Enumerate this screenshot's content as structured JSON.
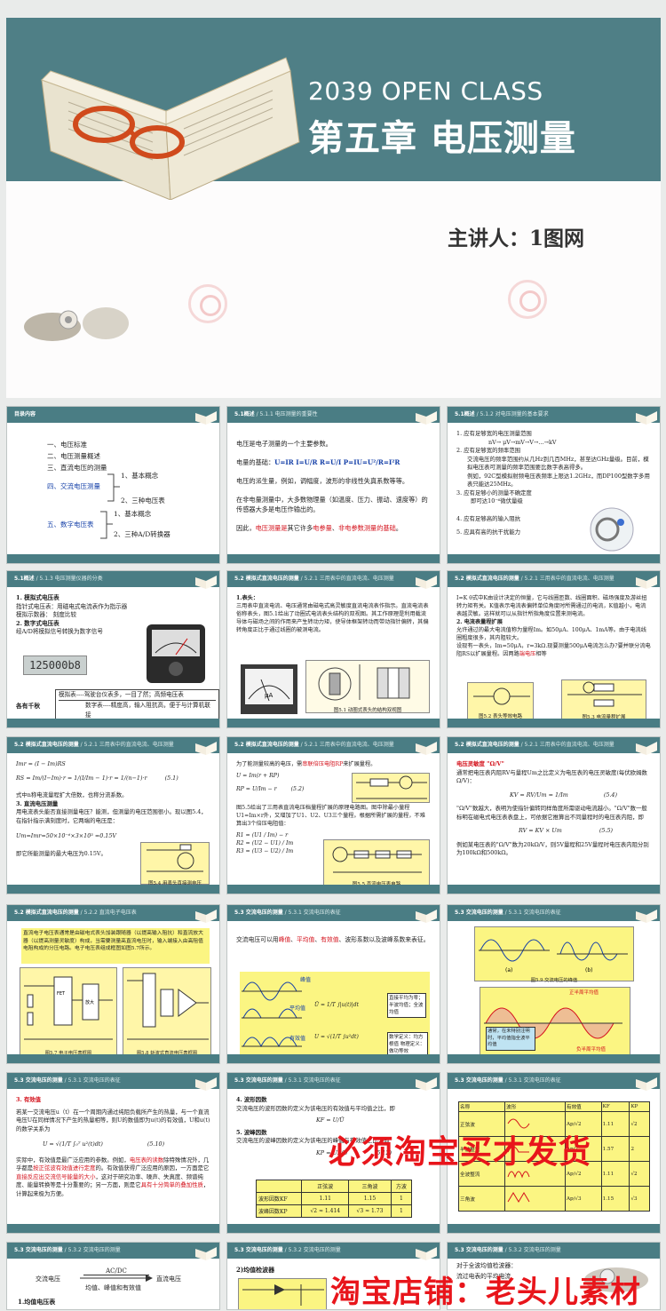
{
  "cover": {
    "title_en": "2039 OPEN CLASS",
    "title_cn": "第五章  电压测量",
    "presenter": "主讲人：1图网"
  },
  "slides": {
    "toc": {
      "bar": "目录内容",
      "items": [
        "一、电压标准",
        "二、电压测量概述",
        "三、直流电压的测量",
        "四、交流电压测量",
        "五、数字电压表"
      ],
      "sub1": [
        "1、基本概念",
        "2、三种电压表"
      ],
      "sub2": [
        "1、基本概念",
        "2、三种A/D转换器"
      ]
    },
    "s512": {
      "bar_a": "5.1概述",
      "bar_b": "/ 5.1.1  电压测量的重要性",
      "l1": "电压是电子测量的一个主要参数。",
      "l2a": "电量的基础：",
      "l2b": "U=IR  I=U/R  R=U/I   P=IU=U²/R=I²R",
      "l3": "电压的派生量，例如，调幅度，波形的非线性失真系数等等。",
      "l4": "在非电量测量中，大多数物理量（如温度、压力、振动、速度等）的传感器大多是电压作输出的。",
      "l5a": "因此，",
      "l5b": "电压测量是",
      "l5c": "其它许多",
      "l5d": "电参量",
      "l5e": "、",
      "l5f": "非电参数测量的基础",
      "l5g": "。"
    },
    "s513": {
      "bar_a": "5.1概述",
      "bar_b": "/ 5.1.2  对电压测量的基本要求",
      "i1": "1. 应有足够宽的电压测量范围",
      "i1b": "nV→ μV→mV→V→…→kV",
      "i2": "2. 应有足够宽的频率范围",
      "i2b": "交流电压的频率范围约从几Hz到几百MHz，甚至达GHz量级。目前，模拟电压表可测量的频率范围要比数字表高得多。",
      "i2c": "例如，92C型模拟射频电压表频率上限达1.2GHz，而DP100型数字多用表只能达25MHz。",
      "i3": "3. 应有足够小的测量不确定度",
      "i3b": "即可达10⁻⁶微伏量级",
      "i4": "4. 应有足够高的输入阻抗",
      "i5": "5. 应具有高的抗干扰能力"
    },
    "s521": {
      "bar_a": "5.1概述",
      "bar_b": "/ 5.1.3  电压测量仪器的分类",
      "h1": "1. 模拟式电压表",
      "t1": "指针式电压表：用磁电式电流表作为指示器",
      "t2": "模拟示数器：  刻度比较",
      "h2": "2. 数字式电压表",
      "t3": "经A/D将模拟信号转换为数字信号",
      "display": "125000b8",
      "row1": "模拟表----驾驶台仪表多，一目了然；高频电压表",
      "row2": "数字表----精度高，输入阻抗高，便于与计算机联接",
      "left": "各有千秋"
    },
    "s522": {
      "bar_a": "5.2  模拟式直流电压的测量",
      "bar_b": "/ 5.2.1  三用表中的直流电流、电压测量",
      "h": "1.表头：",
      "t": "三用表中直流电流、电压通常由磁电式高灵敏度直流电流表作指示。直流电流表俗称表头，图5.1给出了动圈式电流表头结构的双视图。其工作原理是利用载流导体与磁场之间的作用来产生转动力矩，使导体框架转动而带动指针偏转，其偏转角度正比于通过线圈的被测电流。",
      "cap": "图5.1  动圈式表头的结构双视图"
    },
    "s523": {
      "bar_a": "5.2  模拟式直流电压的测量",
      "bar_b": "/ 5.2.1  三用表中的直流电流、电压测量",
      "t1": "I=K θ式中K由设计决定的恒量，它与线圈匝数、线圈面积、磁场强度及游丝扭转力矩有关。K值表示电流表偏转单位角度时所需通过的电流，K值越小，电流表越灵敏。这样就可以从指针所指角度位置来测电流。",
      "h2": "2. 电流表量程扩展",
      "t2": "允许通过的最大电流值称为量程Im。如50μA、100μA、1mA等。由于电流线圈粗度很多，其内阻较大。",
      "t3": "设现有一表头，Im=50μA，r=3kΩ.现要测量500μA电流怎么办?要并联分流电阻RS以扩展量程。",
      "t3b": "因两路",
      "t3c": "端电压",
      "t3d": "相等",
      "cap1": "图5.2  表头等效电路",
      "cap2": "图5.3  电流量程扩展"
    },
    "s531": {
      "bar_a": "5.2  模拟式直流电压的测量",
      "bar_b": "/ 5.2.1  三用表中的直流电流、电压测量",
      "eq1": "Imr = (I − Im)RS",
      "eq2": "RS = Im/(I−Im)·r = 1/(I/Im − 1)·r = 1/(n−1)·r",
      "eqn": "(5.1)",
      "t1": "式中n称电流量程扩大倍数，也称分流系数。",
      "h3": "3. 直流电压测量",
      "t2": "用电流表头能否直接测量电压？能测，但测量的电压范围很小。现以图5.4，在指针指示满刻度时，它两端的电压是：",
      "eq3": "Um=Imr=50×10⁻⁶×3×10³ =0.15V",
      "t3": "即它所能测量的最大电压为0.15V。",
      "cap": "图5.4  用表头直接测电压"
    },
    "s532": {
      "bar_a": "5.2  模拟式直流电压的测量",
      "bar_b": "/ 5.2.1  三用表中的直流电流、电压测量",
      "t1a": "为了能测量较高的电压，需",
      "t1b": "串联倍压电阻RP",
      "t1c": "来扩展量程。",
      "eq1": "U = Im(r + RP)",
      "eq2": "RP = U/Im − r",
      "eqn": "(5.2)",
      "t2": "图5.5给出了三用表直流电压档量程扩展的原理电路图。图中除最小量程U1=Im×r外，又增加了U1、U2、U3三个量程。根据所需扩展的量程，不难算出3个倍压电阻值：",
      "r1": "R1 = (U1 / Im) − r",
      "r2": "R2 = (U2 − U1) / Im",
      "r3": "R3 = (U3 − U2) / Im",
      "cap": "图5.5  直流电压表电路"
    },
    "s533": {
      "bar_a": "5.2  模拟式直流电压的测量",
      "bar_b": "/ 5.2.1  三用表中的直流电流、电压测量",
      "h": "电压灵敏度  \"Ω/V\"",
      "t1": "通常把电压表内阻RV与量程Um之比定义为电压表的电压灵敏度(每伏欧姆数Ω/V)：",
      "eq1": "KV = RV/Um = 1/Im",
      "eqn1": "(5.4)",
      "t2": "\"Ω/V\"数越大，表明为使指针偏转同样角度所需驱动电流越小。\"Ω/V\"数一般标明在磁电式电压表表盘上，可依据它推算出不同量程时的电压表内阻，即",
      "eq2": "RV = KV × Um",
      "eqn2": "(5.5)",
      "t3": "例如某电压表的\"Ω/V\"数为20kΩ/V，则5V量程和25V量程时电压表内阻分别为100kΩ和500kΩ。"
    },
    "s541": {
      "bar_a": "5.2  模拟式直流电压的测量",
      "bar_b": "/ 5.2.2  直流电子电压表",
      "t": "直流电子电压表通常是由磁电式表头加装跟随器（以提高输入阻抗）和直流放大器（以提高测量灵敏度）构成，当需要测量高直流电压时，输入端接入由高阻值电阻构成的分压电路。电子电压表组成框图如图5.7所示。",
      "fet": "FET阻抗变换器",
      "amp": "放大器",
      "div": "分压器",
      "cap1": "图5.7  电子电压表框图",
      "cap2": "图5.8  斩波式直流电压表框图"
    },
    "s542": {
      "bar_a": "5.3  交流电压的测量",
      "bar_b": "/ 5.3.1  交流电压的表征",
      "t1a": "交流电压可以用",
      "t1b": "峰值",
      "t1c": "、",
      "t1d": "平均值",
      "t1e": "、",
      "t1f": "有效值",
      "t1g": "、波形系数以及波峰系数来表征。",
      "lab1": "峰值",
      "lab2": "平均值",
      "lab3": "有效值",
      "box1": "直接平均为零；半波均值；全波均值",
      "box2": "数学定义：均方根值  物理定义：做功等效"
    },
    "s543": {
      "bar_a": "5.3  交流电压的测量",
      "bar_b": "/ 5.3.1  交流电压的表征",
      "cap": "图5.9  交流电压的峰值",
      "note1": "正半周平均值",
      "note2": "通常，在未特别注明时，平均值指全波平均值",
      "note3": "负半周平均值"
    },
    "s551": {
      "bar_a": "5.3  交流电压的测量",
      "bar_b": "/ 5.3.1  交流电压的表征",
      "h": "3. 有效值",
      "t1": "若某一交流电压u（t）在一个周期内通过纯阻负载所产生的热量，与一个直流电压U在同样情况下产生的热量相等，则U的数值即为u(t)的有效值，U和u(t)的数学关系为",
      "eq": "U = √(1/T ∫₀ᵀ u²(t)dt)",
      "eqn": "(5.10)",
      "t2a": "实际中，有效值是最广泛应用的参数。例如，",
      "t2b": "电压表的读数",
      "t2c": "除特殊情况外，几乎都是",
      "t2d": "按正弦波有效值进行定度",
      "t2e": "的。有效值获得广泛应用的原因，一方面是它",
      "t2f": "直接反应出交流信号能量的大小",
      "t2g": "，这对于研究功率、噪声、失真度、频谱纯度、能量转换等是十分重要的；另一方面，则是它",
      "t2h": "具有十分简单的叠加性质",
      "t2i": "，计算起来极为方便。"
    },
    "s552": {
      "bar_a": "5.3  交流电压的测量",
      "bar_b": "/ 5.3.1  交流电压的表征",
      "h4": "4. 波形因数",
      "t4": "交流电压的波形因数的定义为该电压的有效值与平均值之比，即",
      "eq4": "KF = U/Ū",
      "h5": "5. 波峰因数",
      "t5": "交流电压的波峰因数的定义为该电压的峰值与有效值之比，即",
      "eq5": "KP = UP/U",
      "eqn": "(5.12)",
      "th": [
        "",
        "正弦波",
        "三角波",
        "方波"
      ],
      "r1": [
        "波形因数KF",
        "1.11",
        "1.15",
        "1"
      ],
      "r2": [
        "波峰因数KP",
        "√2 ≈ 1.414",
        "√3 ≈ 1.73",
        "1"
      ]
    },
    "s553": {
      "bar_a": "5.3  交流电压的测量",
      "bar_b": "/ 5.3.1  交流电压的表征",
      "th": [
        "名称",
        "波形",
        "有效值",
        "KF",
        "KP"
      ],
      "r1": [
        "正弦波",
        "",
        "Ap/√2",
        "1.11",
        "√2"
      ],
      "r2": [
        "半波整流",
        "",
        "Ap/2",
        "1.57",
        "2"
      ],
      "r3": [
        "全波整流",
        "",
        "Ap/√2",
        "1.11",
        "√2"
      ],
      "r4": [
        "三角波",
        "",
        "Ap/√3",
        "1.15",
        "√3"
      ]
    },
    "s561": {
      "bar_a": "5.3  交流电压的测量",
      "bar_b": "/ 5.3.2  交流电压的测量",
      "left": "交流电压",
      "top": "AC/DC",
      "right": "直流电压",
      "bottom": "均值、峰值和有效值",
      "h": "1.均值电压表"
    },
    "s562": {
      "bar_a": "5.3  交流电压的测量",
      "bar_b": "/ 5.3.2  交流电压的测量",
      "h": "2)均值检波器"
    },
    "s563": {
      "bar_a": "5.3  交流电压的测量",
      "bar_b": "/ 5.3.2  交流电压的测量",
      "h": "对于全波均值检波器：",
      "t": "流过电表的平均电流"
    }
  },
  "watermark": {
    "line1": "必须淘宝买才发货",
    "line2": "淘宝店铺：老头儿素材"
  }
}
